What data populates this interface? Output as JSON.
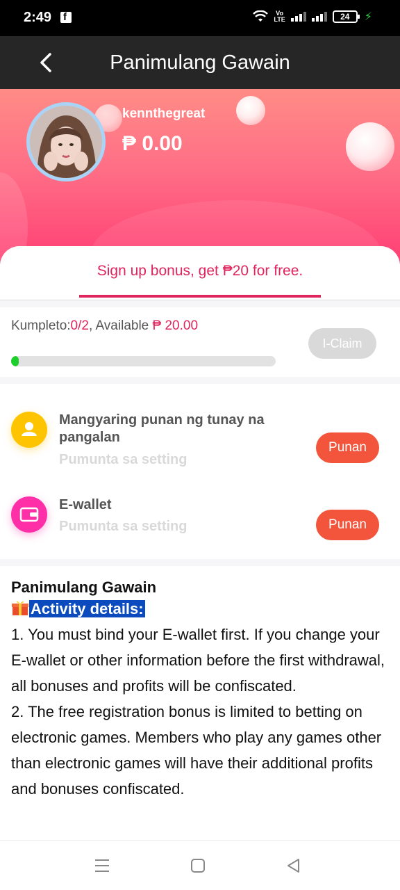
{
  "status_bar": {
    "time": "2:49",
    "volte_top": "Vo",
    "volte_bottom": "LTE",
    "battery": "24",
    "icons": [
      "facebook-icon",
      "wifi-icon",
      "signal-icon",
      "battery-icon",
      "charging-icon"
    ]
  },
  "header": {
    "title": "Panimulang Gawain"
  },
  "profile": {
    "username": "kennthegreat",
    "balance": "₱ 0.00"
  },
  "tab": {
    "label": "Sign up bonus, get ₱20 for free."
  },
  "progress": {
    "label": "Kumpleto:",
    "count": "0/2",
    "separator": ", Available ",
    "amount": "₱ 20.00",
    "fraction": 0.03,
    "claim_label": "I-Claim"
  },
  "tasks": [
    {
      "title": "Mangyaring punan ng tunay na pangalan",
      "subtitle": "Pumunta sa setting",
      "button": "Punan",
      "icon": "user-icon",
      "icon_color": "#ffc400"
    },
    {
      "title": "E-wallet",
      "subtitle": "Pumunta sa setting",
      "button": "Punan",
      "icon": "wallet-icon",
      "icon_color": "#ff2fa8"
    }
  ],
  "details": {
    "title": "Panimulang Gawain",
    "heading": "Activity details:",
    "paragraph1": "1. You must bind your E-wallet first. If you change your E-wallet or other information before the first withdrawal, all bonuses and profits will be confiscated.",
    "paragraph2": "2. The free registration bonus is limited to betting on electronic games. Members who play any games other than electronic games will have their additional profits and bonuses confiscated."
  },
  "colors": {
    "accent": "#e0245e",
    "button": "#f2553b",
    "progress": "#1ccf2a"
  }
}
